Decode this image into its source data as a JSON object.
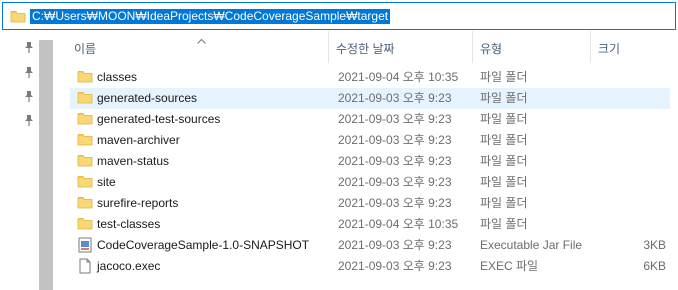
{
  "address": {
    "path": "C:₩Users₩MOON₩IdeaProjects₩CodeCoverageSample₩target"
  },
  "columns": {
    "name": "이름",
    "date": "수정한 날짜",
    "type": "유형",
    "size": "크기"
  },
  "colors": {
    "selection": "#0078d7",
    "row_selected": "#e5f3ff",
    "folder": "#f8d775",
    "header_text": "#4c607a"
  },
  "files": [
    {
      "name": "classes",
      "date": "2021-09-04 오후 10:35",
      "type": "파일 폴더",
      "size": "",
      "icon": "folder-icon"
    },
    {
      "name": "generated-sources",
      "date": "2021-09-03 오후 9:23",
      "type": "파일 폴더",
      "size": "",
      "icon": "folder-icon"
    },
    {
      "name": "generated-test-sources",
      "date": "2021-09-03 오후 9:23",
      "type": "파일 폴더",
      "size": "",
      "icon": "folder-icon"
    },
    {
      "name": "maven-archiver",
      "date": "2021-09-03 오후 9:23",
      "type": "파일 폴더",
      "size": "",
      "icon": "folder-icon"
    },
    {
      "name": "maven-status",
      "date": "2021-09-03 오후 9:23",
      "type": "파일 폴더",
      "size": "",
      "icon": "folder-icon"
    },
    {
      "name": "site",
      "date": "2021-09-03 오후 9:23",
      "type": "파일 폴더",
      "size": "",
      "icon": "folder-icon"
    },
    {
      "name": "surefire-reports",
      "date": "2021-09-03 오후 9:23",
      "type": "파일 폴더",
      "size": "",
      "icon": "folder-icon"
    },
    {
      "name": "test-classes",
      "date": "2021-09-04 오후 10:35",
      "type": "파일 폴더",
      "size": "",
      "icon": "folder-icon"
    },
    {
      "name": "CodeCoverageSample-1.0-SNAPSHOT",
      "date": "2021-09-03 오후 9:23",
      "type": "Executable Jar File",
      "size": "3KB",
      "icon": "jar-file-icon"
    },
    {
      "name": "jacoco.exec",
      "date": "2021-09-03 오후 9:23",
      "type": "EXEC 파일",
      "size": "6KB",
      "icon": "file-icon"
    }
  ]
}
